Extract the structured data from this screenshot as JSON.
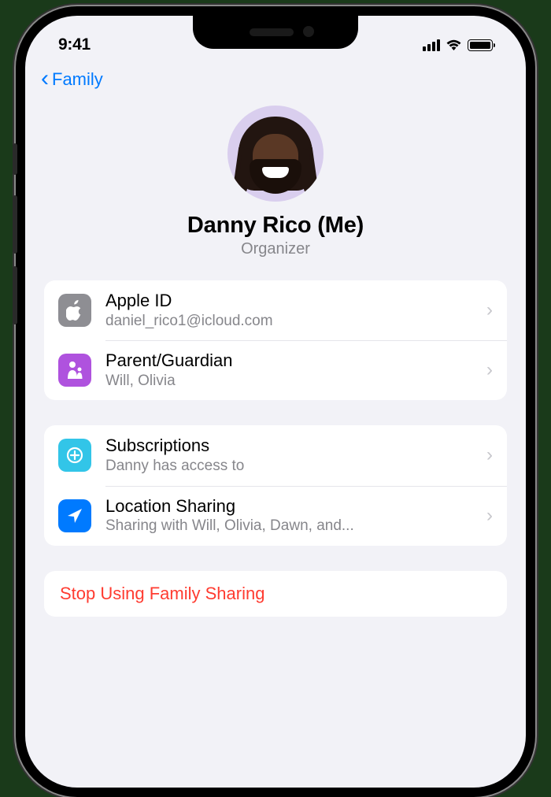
{
  "status_bar": {
    "time": "9:41"
  },
  "nav": {
    "back_label": "Family"
  },
  "profile": {
    "name": "Danny Rico (Me)",
    "role": "Organizer"
  },
  "groups": [
    {
      "rows": [
        {
          "icon": "apple-logo-icon",
          "icon_color": "gray",
          "title": "Apple ID",
          "subtitle": "daniel_rico1@icloud.com"
        },
        {
          "icon": "parent-guardian-icon",
          "icon_color": "purple",
          "title": "Parent/Guardian",
          "subtitle": "Will, Olivia"
        }
      ]
    },
    {
      "rows": [
        {
          "icon": "subscriptions-icon",
          "icon_color": "cyan",
          "title": "Subscriptions",
          "subtitle": "Danny has access to"
        },
        {
          "icon": "location-sharing-icon",
          "icon_color": "blue",
          "title": "Location Sharing",
          "subtitle": "Sharing with Will, Olivia, Dawn, and..."
        }
      ]
    }
  ],
  "destructive_action": {
    "label": "Stop Using Family Sharing"
  },
  "colors": {
    "accent": "#007aff",
    "destructive": "#ff3b30",
    "background": "#f2f2f7"
  }
}
